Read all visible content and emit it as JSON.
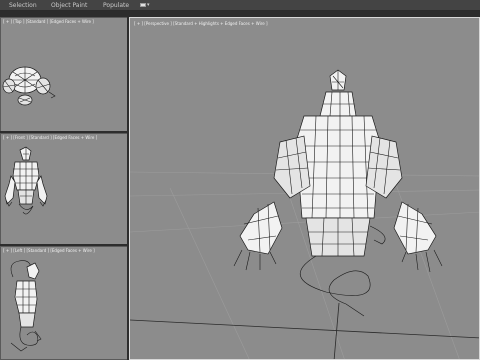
{
  "ribbon": {
    "tabs": [
      "Selection",
      "Object Paint",
      "Populate"
    ]
  },
  "viewports": {
    "top": {
      "label": "[ + ] [Top ] [Standard ] [Edged Faces + Wire ]"
    },
    "front": {
      "label": "[ + ] [Front ] [Standard ] [Edged Faces + Wire ]"
    },
    "left": {
      "label": "[ + ] [Left ] [Standard ] [Edged Faces + Wire ]"
    },
    "perspective": {
      "label": "[ + ] [Perspective ] [Standard + Highlights + Edged Faces + Wire ]"
    }
  },
  "colors": {
    "viewport_bg": "#8c8c8c",
    "active_border": "#d8d8d8",
    "ui_bg": "#3a3a3a"
  }
}
